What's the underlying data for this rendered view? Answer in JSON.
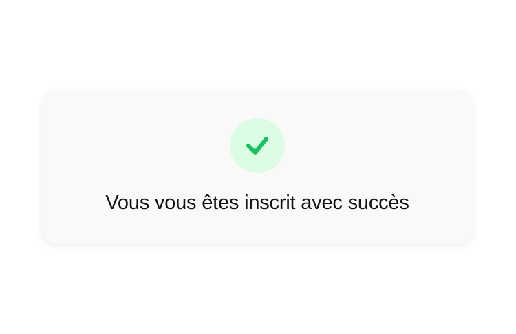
{
  "success_card": {
    "icon": "check-icon",
    "icon_color": "#16c35e",
    "icon_background": "#dcfce3",
    "message": "Vous vous êtes inscrit avec succès"
  }
}
